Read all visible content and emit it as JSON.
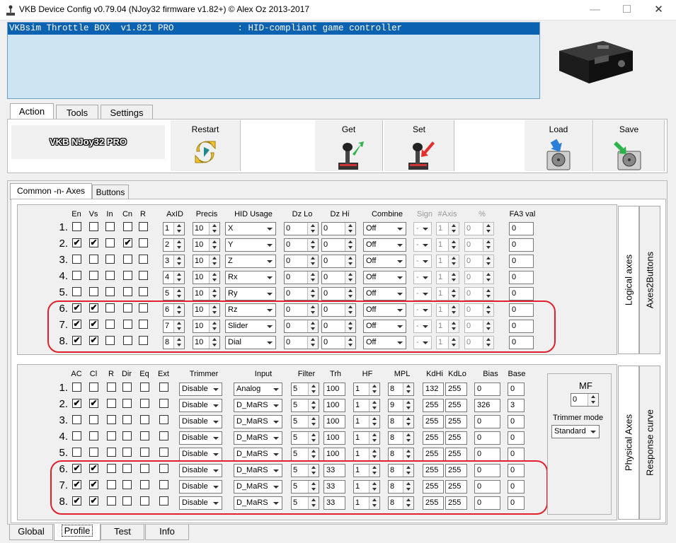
{
  "window": {
    "title": "VKB Device Config v0.79.04 (NJoy32 firmware v1.82+) © Alex Oz 2013-2017",
    "min": "—",
    "max": "☐",
    "close": "✕"
  },
  "device_line": "VKBsim Throttle BOX  v1.821 PRO            : HID-compliant game controller",
  "top_tabs": [
    "Action",
    "Tools",
    "Settings"
  ],
  "brand": "VKB NJoy32 PRO",
  "toolbar": {
    "restart": "Restart",
    "get": "Get",
    "set": "Set",
    "load": "Load",
    "save": "Save"
  },
  "sub_tabs": [
    "Common -n- Axes",
    "Buttons"
  ],
  "logical": {
    "vtab1": "Logical axes",
    "vtab2": "Axes2Buttons",
    "headers": [
      "En",
      "Vs",
      "In",
      "Cn",
      "R",
      "AxID",
      "Precis",
      "HID Usage",
      "Dz Lo",
      "Dz Hi",
      "Combine",
      "Sign",
      "#Axis",
      "%",
      "FA3 val"
    ],
    "rows": [
      {
        "n": "1.",
        "en": false,
        "vs": false,
        "in": false,
        "cn": false,
        "r": false,
        "axid": "1",
        "precis": "10",
        "hid": "X",
        "dzlo": "0",
        "dzhi": "0",
        "combine": "Off",
        "sign": "-",
        "naxis": "1",
        "pct": "0",
        "fa3": "0"
      },
      {
        "n": "2.",
        "en": true,
        "vs": true,
        "in": false,
        "cn": true,
        "r": false,
        "axid": "2",
        "precis": "10",
        "hid": "Y",
        "dzlo": "0",
        "dzhi": "0",
        "combine": "Off",
        "sign": "-",
        "naxis": "1",
        "pct": "0",
        "fa3": "0"
      },
      {
        "n": "3.",
        "en": false,
        "vs": false,
        "in": false,
        "cn": false,
        "r": false,
        "axid": "3",
        "precis": "10",
        "hid": "Z",
        "dzlo": "0",
        "dzhi": "0",
        "combine": "Off",
        "sign": "-",
        "naxis": "1",
        "pct": "0",
        "fa3": "0"
      },
      {
        "n": "4.",
        "en": false,
        "vs": false,
        "in": false,
        "cn": false,
        "r": false,
        "axid": "4",
        "precis": "10",
        "hid": "Rx",
        "dzlo": "0",
        "dzhi": "0",
        "combine": "Off",
        "sign": "-",
        "naxis": "1",
        "pct": "0",
        "fa3": "0"
      },
      {
        "n": "5.",
        "en": false,
        "vs": false,
        "in": false,
        "cn": false,
        "r": false,
        "axid": "5",
        "precis": "10",
        "hid": "Ry",
        "dzlo": "0",
        "dzhi": "0",
        "combine": "Off",
        "sign": "-",
        "naxis": "1",
        "pct": "0",
        "fa3": "0"
      },
      {
        "n": "6.",
        "en": true,
        "vs": true,
        "in": false,
        "cn": false,
        "r": false,
        "axid": "6",
        "precis": "10",
        "hid": "Rz",
        "dzlo": "0",
        "dzhi": "0",
        "combine": "Off",
        "sign": "-",
        "naxis": "1",
        "pct": "0",
        "fa3": "0"
      },
      {
        "n": "7.",
        "en": true,
        "vs": true,
        "in": false,
        "cn": false,
        "r": false,
        "axid": "7",
        "precis": "10",
        "hid": "Slider",
        "dzlo": "0",
        "dzhi": "0",
        "combine": "Off",
        "sign": "-",
        "naxis": "1",
        "pct": "0",
        "fa3": "0"
      },
      {
        "n": "8.",
        "en": true,
        "vs": true,
        "in": false,
        "cn": false,
        "r": false,
        "axid": "8",
        "precis": "10",
        "hid": "Dial",
        "dzlo": "0",
        "dzhi": "0",
        "combine": "Off",
        "sign": "-",
        "naxis": "1",
        "pct": "0",
        "fa3": "0"
      }
    ]
  },
  "physical": {
    "vtab1": "Physical Axes",
    "vtab2": "Response curve",
    "headers": [
      "AC",
      "Cl",
      "R",
      "Dir",
      "Eq",
      "Ext",
      "Trimmer",
      "Input",
      "Filter",
      "Trh",
      "HF",
      "MPL",
      "KdHi",
      "KdLo",
      "Bias",
      "Base"
    ],
    "rows": [
      {
        "n": "1.",
        "ac": false,
        "cl": false,
        "r": false,
        "dir": false,
        "eq": false,
        "ext": false,
        "trimmer": "Disable",
        "input": "Analog",
        "filter": "5",
        "trh": "100",
        "hf": "1",
        "mpl": "8",
        "kdhi": "132",
        "kdlo": "255",
        "bias": "0",
        "base": "0"
      },
      {
        "n": "2.",
        "ac": true,
        "cl": true,
        "r": false,
        "dir": false,
        "eq": false,
        "ext": false,
        "trimmer": "Disable",
        "input": "D_MaRS",
        "filter": "5",
        "trh": "100",
        "hf": "1",
        "mpl": "9",
        "kdhi": "255",
        "kdlo": "255",
        "bias": "326",
        "base": "3"
      },
      {
        "n": "3.",
        "ac": false,
        "cl": false,
        "r": false,
        "dir": false,
        "eq": false,
        "ext": false,
        "trimmer": "Disable",
        "input": "D_MaRS",
        "filter": "5",
        "trh": "100",
        "hf": "1",
        "mpl": "8",
        "kdhi": "255",
        "kdlo": "255",
        "bias": "0",
        "base": "0"
      },
      {
        "n": "4.",
        "ac": false,
        "cl": false,
        "r": false,
        "dir": false,
        "eq": false,
        "ext": false,
        "trimmer": "Disable",
        "input": "D_MaRS",
        "filter": "5",
        "trh": "100",
        "hf": "1",
        "mpl": "8",
        "kdhi": "255",
        "kdlo": "255",
        "bias": "0",
        "base": "0"
      },
      {
        "n": "5.",
        "ac": false,
        "cl": false,
        "r": false,
        "dir": false,
        "eq": false,
        "ext": false,
        "trimmer": "Disable",
        "input": "D_MaRS",
        "filter": "5",
        "trh": "100",
        "hf": "1",
        "mpl": "8",
        "kdhi": "255",
        "kdlo": "255",
        "bias": "0",
        "base": "0"
      },
      {
        "n": "6.",
        "ac": true,
        "cl": true,
        "r": false,
        "dir": false,
        "eq": false,
        "ext": false,
        "trimmer": "Disable",
        "input": "D_MaRS",
        "filter": "5",
        "trh": "33",
        "hf": "1",
        "mpl": "8",
        "kdhi": "255",
        "kdlo": "255",
        "bias": "0",
        "base": "0"
      },
      {
        "n": "7.",
        "ac": true,
        "cl": true,
        "r": false,
        "dir": false,
        "eq": false,
        "ext": false,
        "trimmer": "Disable",
        "input": "D_MaRS",
        "filter": "5",
        "trh": "33",
        "hf": "1",
        "mpl": "8",
        "kdhi": "255",
        "kdlo": "255",
        "bias": "0",
        "base": "0"
      },
      {
        "n": "8.",
        "ac": true,
        "cl": true,
        "r": false,
        "dir": false,
        "eq": false,
        "ext": false,
        "trimmer": "Disable",
        "input": "D_MaRS",
        "filter": "5",
        "trh": "33",
        "hf": "1",
        "mpl": "8",
        "kdhi": "255",
        "kdlo": "255",
        "bias": "0",
        "base": "0"
      }
    ],
    "mf_label": "MF",
    "mf_value": "0",
    "trimmer_mode_label": "Trimmer mode",
    "trimmer_mode_value": "Standard"
  },
  "bottom_tabs": [
    "Global",
    "Profile",
    "Test",
    "Info"
  ],
  "colors": {
    "selection": "#0a62b0",
    "device_bg": "#cde5f3",
    "highlight": "#e0202c"
  }
}
